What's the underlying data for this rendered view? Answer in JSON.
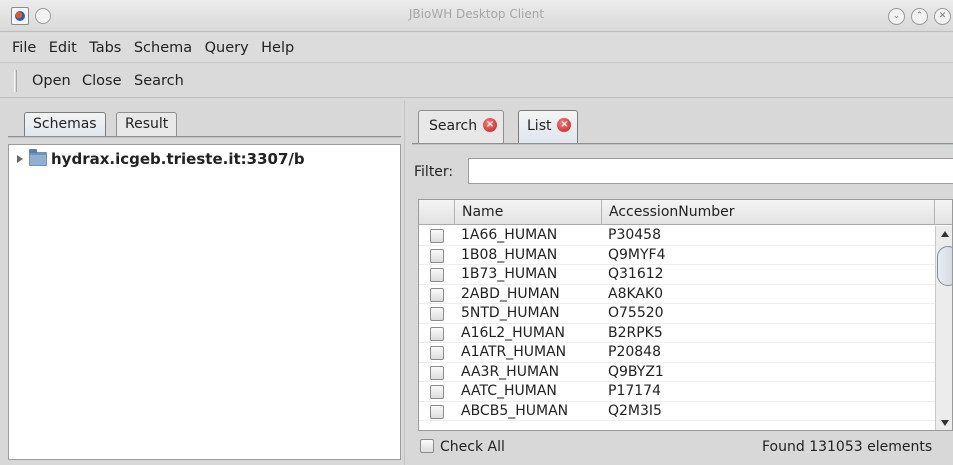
{
  "window": {
    "title": "JBioWH Desktop Client"
  },
  "menubar": {
    "items": [
      "File",
      "Edit",
      "Tabs",
      "Schema",
      "Query",
      "Help"
    ]
  },
  "toolbar": {
    "buttons": [
      "Open",
      "Close",
      "Search"
    ]
  },
  "left_panel": {
    "tabs": [
      "Schemas",
      "Result"
    ],
    "active_tab": "Schemas",
    "tree": {
      "root_label": "hydrax.icgeb.trieste.it:3307/b"
    }
  },
  "right_panel": {
    "tabs": [
      "Search",
      "List"
    ],
    "active_tab": "List",
    "filter_label": "Filter:",
    "filter_value": "",
    "table": {
      "columns": [
        "",
        "Name",
        "AccessionNumber"
      ],
      "rows": [
        {
          "name": "1A66_HUMAN",
          "accession": "P30458"
        },
        {
          "name": "1B08_HUMAN",
          "accession": "Q9MYF4"
        },
        {
          "name": "1B73_HUMAN",
          "accession": "Q31612"
        },
        {
          "name": "2ABD_HUMAN",
          "accession": "A8KAK0"
        },
        {
          "name": "5NTD_HUMAN",
          "accession": "O75520"
        },
        {
          "name": "A16L2_HUMAN",
          "accession": "B2RPK5"
        },
        {
          "name": "A1ATR_HUMAN",
          "accession": "P20848"
        },
        {
          "name": "AA3R_HUMAN",
          "accession": "Q9BYZ1"
        },
        {
          "name": "AATC_HUMAN",
          "accession": "P17174"
        },
        {
          "name": "ABCB5_HUMAN",
          "accession": "Q2M3I5"
        }
      ]
    },
    "check_all_label": "Check All",
    "status_text": "Found 131053 elements"
  }
}
